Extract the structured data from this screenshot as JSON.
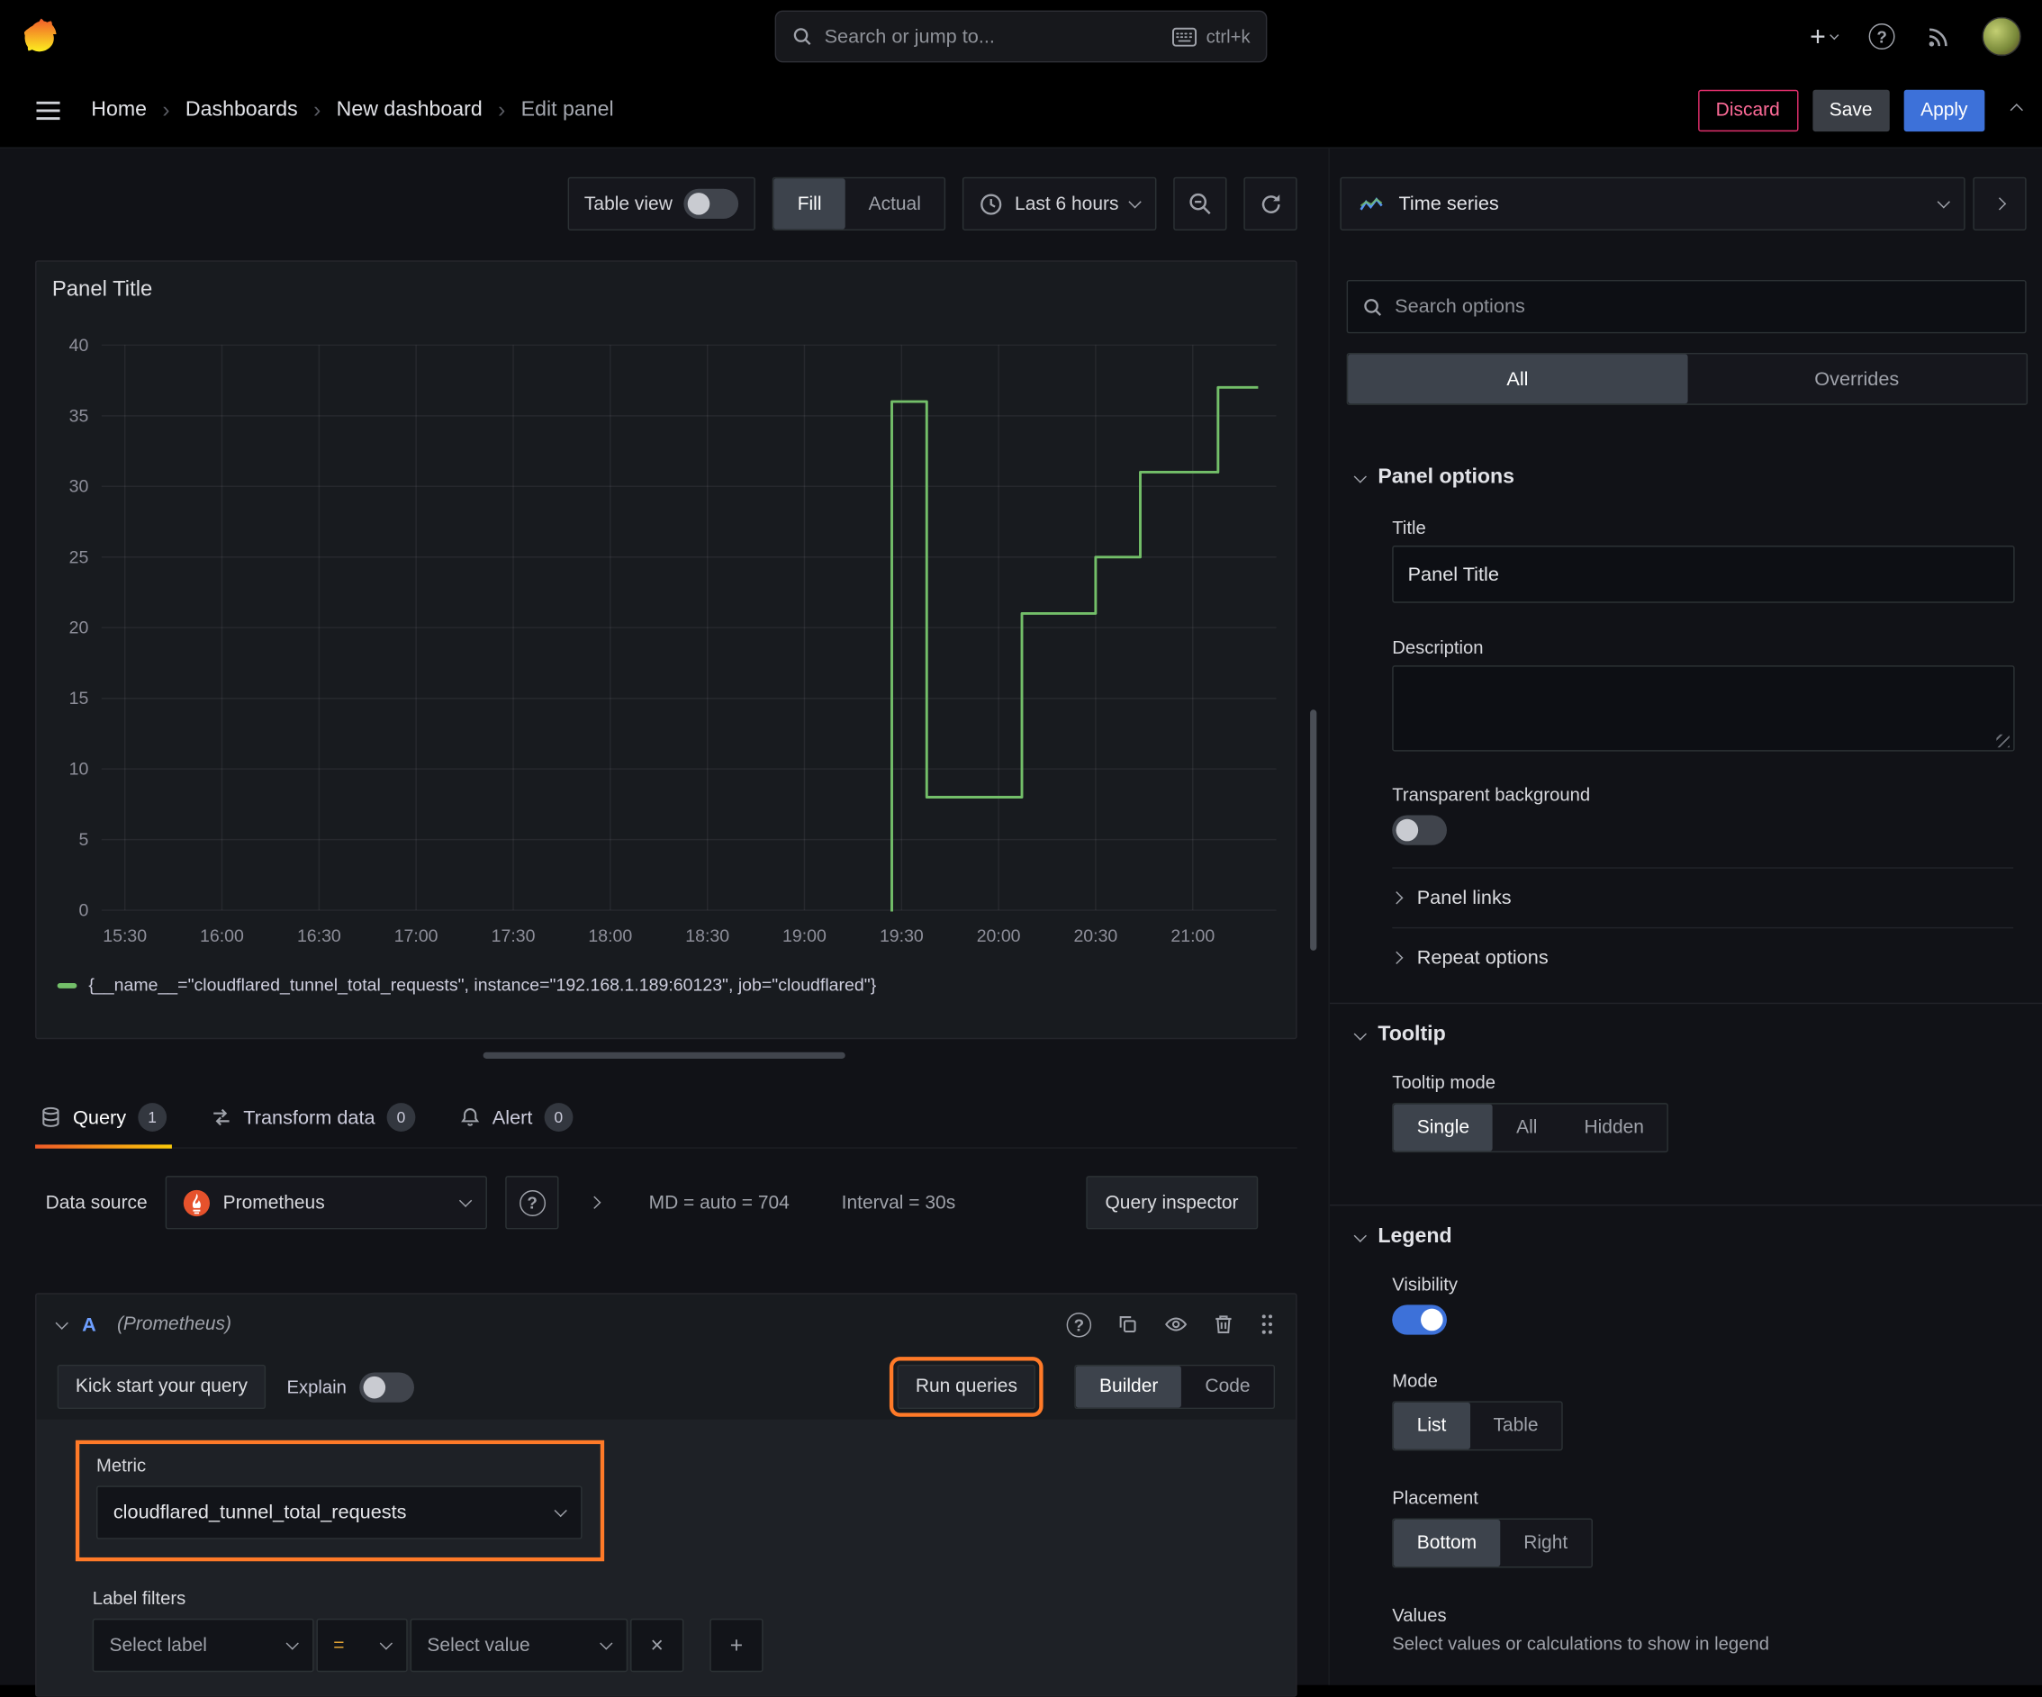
{
  "topnav": {
    "search_placeholder": "Search or jump to...",
    "shortcut": "ctrl+k"
  },
  "breadcrumbs": {
    "home": "Home",
    "dashboards": "Dashboards",
    "new_dashboard": "New dashboard",
    "edit_panel": "Edit panel"
  },
  "actions": {
    "discard": "Discard",
    "save": "Save",
    "apply": "Apply"
  },
  "toolbar": {
    "table_view": "Table view",
    "fill": "Fill",
    "actual": "Actual",
    "time_range": "Last 6 hours"
  },
  "panel": {
    "title": "Panel Title"
  },
  "chart_data": {
    "type": "line",
    "title": "Panel Title",
    "x_unit": "time_of_day_hours",
    "xlim": [
      15.38,
      21.43
    ],
    "ylim": [
      0,
      40
    ],
    "y_ticks": [
      0,
      5,
      10,
      15,
      20,
      25,
      30,
      35,
      40
    ],
    "x_ticks": [
      {
        "v": 15.5,
        "label": "15:30"
      },
      {
        "v": 16.0,
        "label": "16:00"
      },
      {
        "v": 16.5,
        "label": "16:30"
      },
      {
        "v": 17.0,
        "label": "17:00"
      },
      {
        "v": 17.5,
        "label": "17:30"
      },
      {
        "v": 18.0,
        "label": "18:00"
      },
      {
        "v": 18.5,
        "label": "18:30"
      },
      {
        "v": 19.0,
        "label": "19:00"
      },
      {
        "v": 19.5,
        "label": "19:30"
      },
      {
        "v": 20.0,
        "label": "20:00"
      },
      {
        "v": 20.5,
        "label": "20:30"
      },
      {
        "v": 21.0,
        "label": "21:00"
      }
    ],
    "grid": true,
    "legend_position": "bottom",
    "series": [
      {
        "name": "{__name__=\"cloudflared_tunnel_total_requests\", instance=\"192.168.1.189:60123\", job=\"cloudflared\"}",
        "color": "#73bf69",
        "points": [
          [
            19.45,
            0
          ],
          [
            19.45,
            36
          ],
          [
            19.63,
            36
          ],
          [
            19.63,
            8
          ],
          [
            20.12,
            8
          ],
          [
            20.12,
            21
          ],
          [
            20.5,
            21
          ],
          [
            20.5,
            25
          ],
          [
            20.73,
            25
          ],
          [
            20.73,
            31
          ],
          [
            21.13,
            31
          ],
          [
            21.13,
            37
          ],
          [
            21.33,
            37
          ]
        ]
      }
    ]
  },
  "tabs": {
    "query": "Query",
    "query_count": "1",
    "transform": "Transform data",
    "transform_count": "0",
    "alert": "Alert",
    "alert_count": "0"
  },
  "datasource": {
    "label": "Data source",
    "name": "Prometheus",
    "md_info": "MD = auto = 704",
    "interval_info": "Interval = 30s",
    "query_inspector": "Query inspector"
  },
  "query": {
    "ref_id": "A",
    "ds_hint": "(Prometheus)",
    "kick_start": "Kick start your query",
    "explain": "Explain",
    "run_queries": "Run queries",
    "builder": "Builder",
    "code": "Code",
    "metric_label": "Metric",
    "metric_value": "cloudflared_tunnel_total_requests",
    "label_filters": "Label filters",
    "select_label": "Select label",
    "operator": "=",
    "select_value": "Select value"
  },
  "sidebar": {
    "viz_name": "Time series",
    "search_placeholder": "Search options",
    "tab_all": "All",
    "tab_overrides": "Overrides",
    "panel_options": "Panel options",
    "title_label": "Title",
    "title_value": "Panel Title",
    "description_label": "Description",
    "transparent_bg": "Transparent background",
    "panel_links": "Panel links",
    "repeat_options": "Repeat options",
    "tooltip": "Tooltip",
    "tooltip_mode": "Tooltip mode",
    "tt_single": "Single",
    "tt_all": "All",
    "tt_hidden": "Hidden",
    "legend": "Legend",
    "visibility": "Visibility",
    "mode": "Mode",
    "mode_list": "List",
    "mode_table": "Table",
    "placement": "Placement",
    "placement_bottom": "Bottom",
    "placement_right": "Right",
    "values": "Values",
    "values_hint": "Select values or calculations to show in legend"
  },
  "colors": {
    "accent_blue": "#3d71d9",
    "highlight_orange": "#ff7a28",
    "series_green": "#73bf69",
    "danger_pink": "#e02f6c",
    "tab_underline": "#f05a28"
  }
}
